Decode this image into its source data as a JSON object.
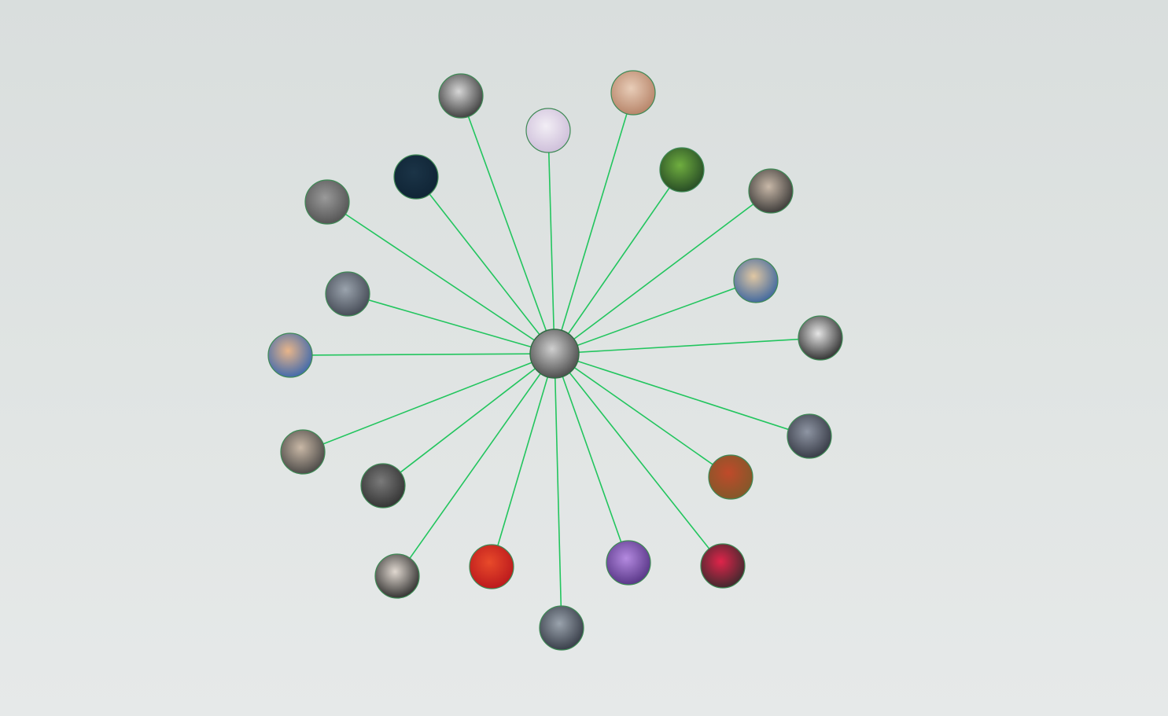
{
  "graph": {
    "edge_color": "#22c55e",
    "center": {
      "id": "center-artist",
      "palette": [
        "#3a3a3a",
        "#cfcfcf"
      ]
    },
    "nodes": [
      {
        "id": "artist-01",
        "palette": [
          "#2b2b2b",
          "#d6d6d6"
        ]
      },
      {
        "id": "artist-02",
        "palette": [
          "#c9b8d6",
          "#f2eef5"
        ]
      },
      {
        "id": "artist-03",
        "palette": [
          "#b07a5e",
          "#e8cdb8"
        ]
      },
      {
        "id": "artist-04",
        "palette": [
          "#0e2233",
          "#1b3447"
        ]
      },
      {
        "id": "artist-05",
        "palette": [
          "#1e3f22",
          "#6fae3f"
        ]
      },
      {
        "id": "artist-06",
        "palette": [
          "#2a2a2a",
          "#c8b8a8"
        ]
      },
      {
        "id": "artist-07",
        "palette": [
          "#4a4a4a",
          "#9a9a9a"
        ]
      },
      {
        "id": "artist-08",
        "palette": [
          "#2b5b9e",
          "#e0c7a3"
        ]
      },
      {
        "id": "artist-09",
        "palette": [
          "#3a3f4a",
          "#9aa3ad"
        ]
      },
      {
        "id": "artist-10",
        "palette": [
          "#1a1a1a",
          "#e5e5e5"
        ]
      },
      {
        "id": "artist-11",
        "palette": [
          "#2a5fb0",
          "#e8b58a"
        ]
      },
      {
        "id": "artist-12",
        "palette": [
          "#2c2f3a",
          "#8e95a3"
        ]
      },
      {
        "id": "artist-13",
        "palette": [
          "#3a3a3a",
          "#c9b8a6"
        ]
      },
      {
        "id": "artist-14",
        "palette": [
          "#7a5a2a",
          "#c04a2a"
        ]
      },
      {
        "id": "artist-15",
        "palette": [
          "#2a2a2a",
          "#7a7a7a"
        ]
      },
      {
        "id": "artist-16",
        "palette": [
          "#1a1a1a",
          "#e0d8d0"
        ]
      },
      {
        "id": "artist-17",
        "palette": [
          "#b5121b",
          "#e84a2a"
        ]
      },
      {
        "id": "artist-18",
        "palette": [
          "#4b2a7a",
          "#b48ae0"
        ]
      },
      {
        "id": "artist-19",
        "palette": [
          "#2a2a2a",
          "#e0244a"
        ]
      },
      {
        "id": "artist-20",
        "palette": [
          "#2a2f3a",
          "#9aa3ad"
        ]
      }
    ]
  }
}
